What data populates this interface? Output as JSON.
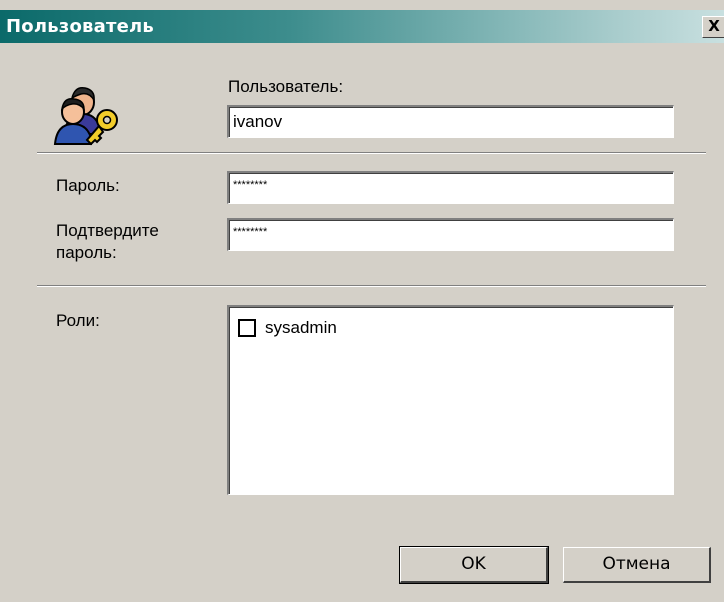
{
  "window": {
    "title": "Пользователь",
    "close_label": "X"
  },
  "icons": {
    "users": "users-key-icon"
  },
  "user": {
    "label": "Пользователь:",
    "value": "ivanov"
  },
  "password": {
    "label": "Пароль:",
    "value": "********"
  },
  "confirm": {
    "label_line1": "Подтвердите",
    "label_line2": "пароль:",
    "value": "********"
  },
  "roles": {
    "label": "Роли:",
    "items": [
      {
        "label": "sysadmin",
        "checked": false
      }
    ]
  },
  "buttons": {
    "ok": "OK",
    "cancel": "Отмена"
  }
}
